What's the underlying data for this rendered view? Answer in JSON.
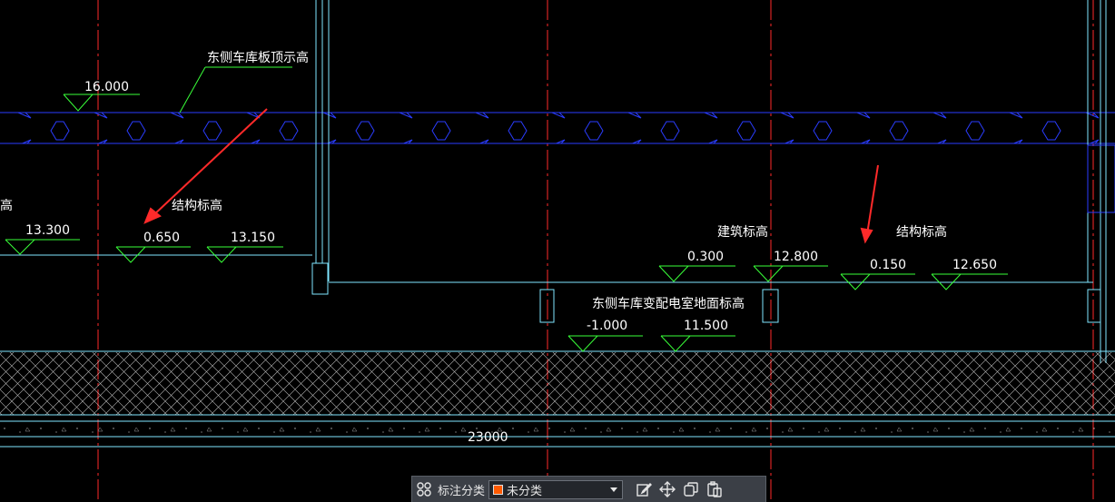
{
  "labels": {
    "roof_note": "东侧车库板顶示高",
    "struct_left": "结构标高",
    "build_right": "建筑标高",
    "struct_right": "结构标高",
    "floor_note": "东侧车库变配电室地面标高",
    "cut_left": "高"
  },
  "elevations": {
    "e16000": "16.000",
    "e13300": "13.300",
    "e0650": "0.650",
    "e13150": "13.150",
    "e0300": "0.300",
    "e12800": "12.800",
    "e0150": "0.150",
    "e12650": "12.650",
    "em1000": "-1.000",
    "e11500": "11.500"
  },
  "dimension": "23000",
  "colors": {
    "background": "#000000",
    "axis": "#ff2a2a",
    "slab": "#2a3cff",
    "outline": "#7fe6ff",
    "leader": "#39ff39",
    "text": "#ffffff",
    "arrow": "#ff2a2a",
    "hatch": "#ffffff",
    "layer_swatch": "#ff5a00"
  },
  "toolbar": {
    "category_label": "标注分类",
    "category_value": "未分类",
    "icons": [
      "grid-icon",
      "edit-icon",
      "move-icon",
      "copy-icon",
      "paste-icon"
    ]
  }
}
